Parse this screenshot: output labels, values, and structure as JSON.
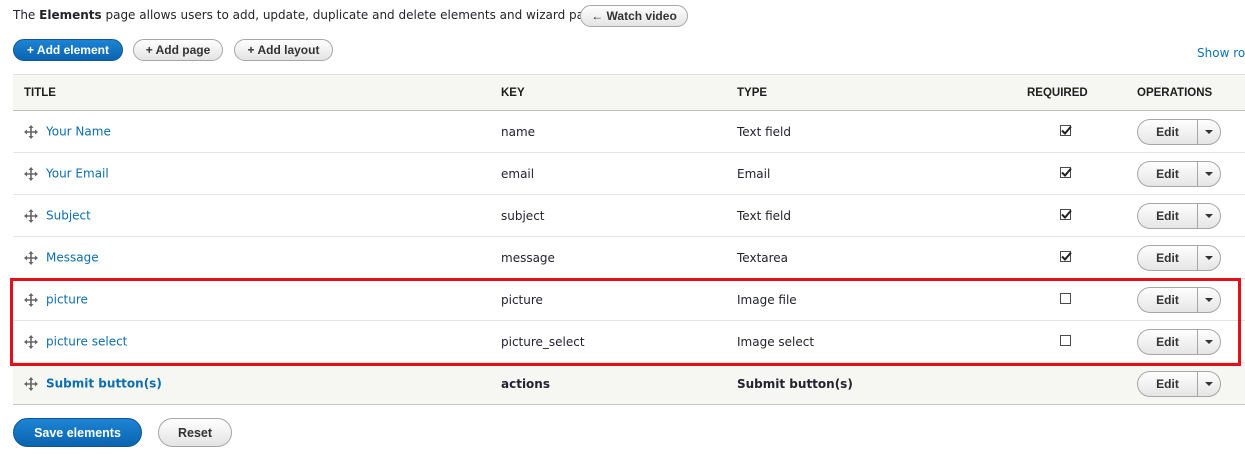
{
  "intro": {
    "prefix": "The ",
    "strong": "Elements",
    "suffix": " page allows users to add, update, duplicate and delete elements and wizard pages."
  },
  "watch_video": "← Watch video",
  "actions": {
    "add_element": "+ Add element",
    "add_page": "+ Add page",
    "add_layout": "+ Add layout"
  },
  "show_row": "Show row",
  "table": {
    "headers": {
      "title": "TITLE",
      "key": "KEY",
      "type": "TYPE",
      "required": "REQUIRED",
      "operations": "OPERATIONS"
    },
    "rows": [
      {
        "title": "Your Name",
        "key": "name",
        "type": "Text field",
        "required": true,
        "op": "Edit"
      },
      {
        "title": "Your Email",
        "key": "email",
        "type": "Email",
        "required": true,
        "op": "Edit"
      },
      {
        "title": "Subject",
        "key": "subject",
        "type": "Text field",
        "required": true,
        "op": "Edit"
      },
      {
        "title": "Message",
        "key": "message",
        "type": "Textarea",
        "required": true,
        "op": "Edit"
      },
      {
        "title": "picture",
        "key": "picture",
        "type": "Image file",
        "required": false,
        "op": "Edit"
      },
      {
        "title": "picture select",
        "key": "picture_select",
        "type": "Image select",
        "required": false,
        "op": "Edit"
      },
      {
        "title": "Submit button(s)",
        "key": "actions",
        "type": "Submit button(s)",
        "required": null,
        "op": "Edit"
      }
    ]
  },
  "footer": {
    "save": "Save elements",
    "reset": "Reset"
  },
  "colors": {
    "primary": "#0a64b0",
    "link": "#0b6ead",
    "highlight": "#e3101b"
  }
}
